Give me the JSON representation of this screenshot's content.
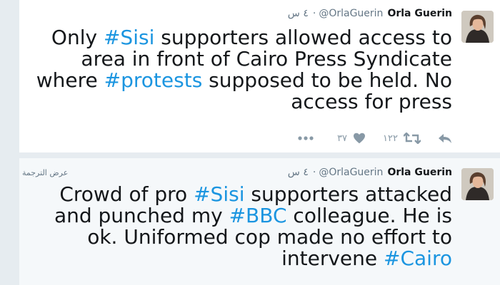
{
  "tweets": [
    {
      "name": "Orla Guerin",
      "handle": "@OrlaGuerin",
      "dot": "·",
      "time": "٤ س",
      "lines": [
        [
          {
            "t": "Only "
          },
          {
            "t": "#Sisi",
            "tag": true
          },
          {
            "t": " supporters allowed access to"
          }
        ],
        [
          {
            "t": "area in front of Cairo Press Syndicate"
          }
        ],
        [
          {
            "t": "where "
          },
          {
            "t": "#protests",
            "tag": true
          },
          {
            "t": " supposed to be held. No"
          }
        ],
        [
          {
            "t": "access for press"
          }
        ]
      ],
      "retweets": "١٢٢",
      "likes": "٣٧"
    },
    {
      "name": "Orla Guerin",
      "handle": "@OrlaGuerin",
      "dot": "·",
      "time": "٤ س",
      "translate_label": "عرض الترجمة",
      "lines": [
        [
          {
            "t": "Crowd of pro "
          },
          {
            "t": "#Sisi",
            "tag": true
          },
          {
            "t": " supporters attacked"
          }
        ],
        [
          {
            "t": "and punched my "
          },
          {
            "t": "#BBC",
            "tag": true
          },
          {
            "t": " colleague. He is"
          }
        ],
        [
          {
            "t": "ok. Uniformed cop made no effort to"
          }
        ],
        [
          {
            "t": "intervene "
          },
          {
            "t": "#Cairo",
            "tag": true
          }
        ]
      ]
    }
  ],
  "colors": {
    "link": "#1b95e0",
    "muted": "#657786",
    "icon": "#8899a6"
  },
  "icons": [
    "reply-icon",
    "retweet-icon",
    "heart-icon",
    "more-icon",
    "avatar"
  ]
}
